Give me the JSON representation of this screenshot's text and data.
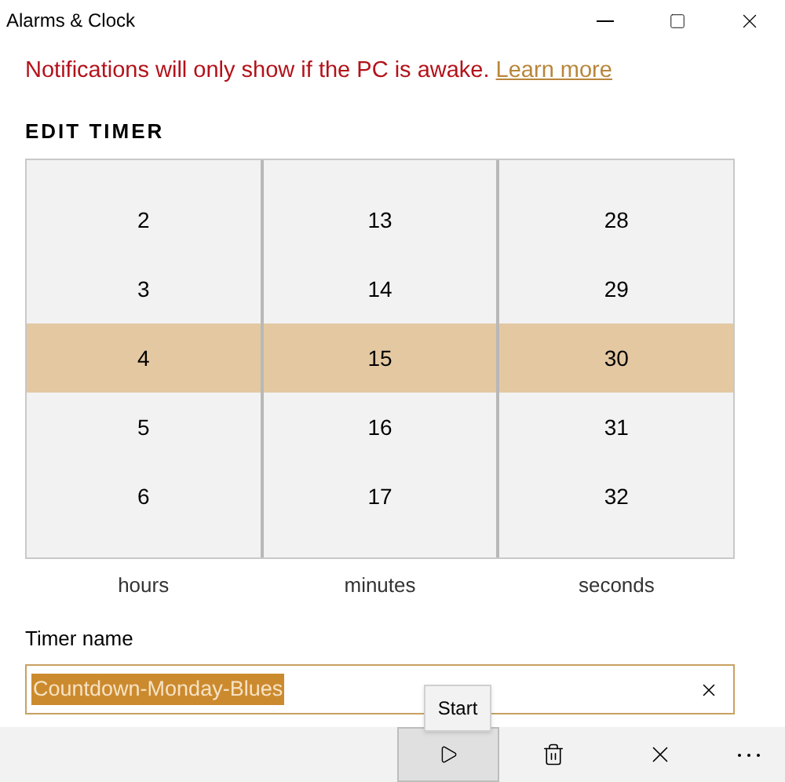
{
  "window": {
    "title": "Alarms & Clock"
  },
  "notice": {
    "text": "Notifications will only show if the PC is awake.",
    "link": "Learn more"
  },
  "heading": "EDIT TIMER",
  "picker": [
    {
      "label": "hours",
      "items": [
        {
          "value": "2",
          "selected": false
        },
        {
          "value": "3",
          "selected": false
        },
        {
          "value": "4",
          "selected": true
        },
        {
          "value": "5",
          "selected": false
        },
        {
          "value": "6",
          "selected": false
        }
      ]
    },
    {
      "label": "minutes",
      "items": [
        {
          "value": "13",
          "selected": false
        },
        {
          "value": "14",
          "selected": false
        },
        {
          "value": "15",
          "selected": true
        },
        {
          "value": "16",
          "selected": false
        },
        {
          "value": "17",
          "selected": false
        }
      ]
    },
    {
      "label": "seconds",
      "items": [
        {
          "value": "28",
          "selected": false
        },
        {
          "value": "29",
          "selected": false
        },
        {
          "value": "30",
          "selected": true
        },
        {
          "value": "31",
          "selected": false
        },
        {
          "value": "32",
          "selected": false
        }
      ]
    }
  ],
  "timer_name": {
    "label": "Timer name",
    "value": "Countdown-Monday-Blues"
  },
  "tooltip": "Start"
}
